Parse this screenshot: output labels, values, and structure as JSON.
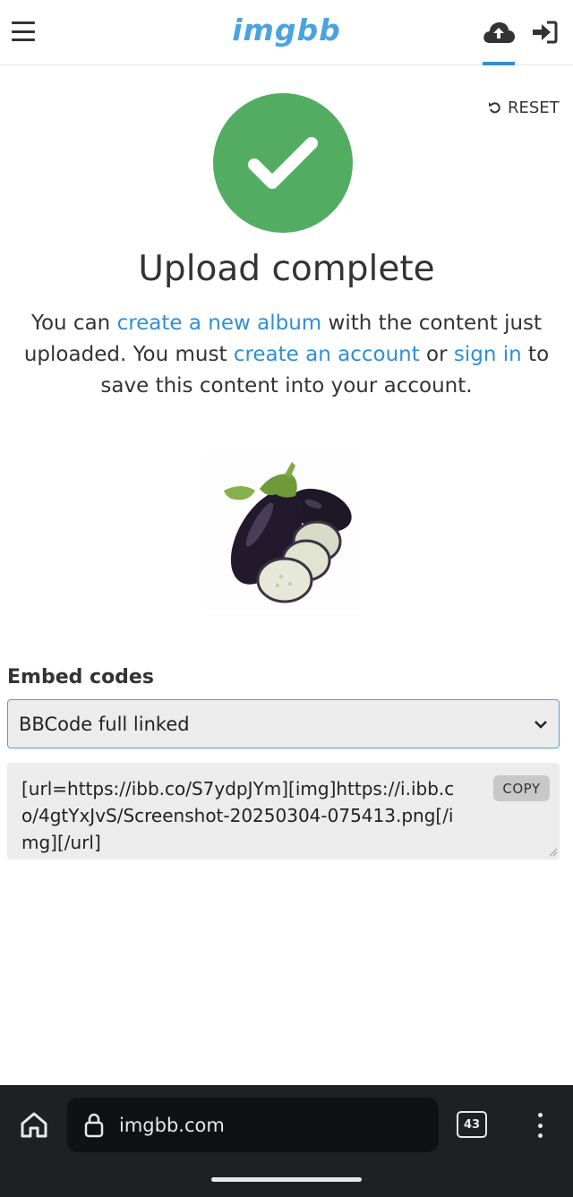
{
  "header": {
    "logo": "imgbb",
    "brand_color": "#4aa3e0",
    "icons": [
      "menu-icon",
      "cloud-upload-icon",
      "sign-in-icon"
    ]
  },
  "reset": {
    "label": "RESET",
    "icon": "undo-icon"
  },
  "success": {
    "icon": "checkmark-icon",
    "color": "#52ad63",
    "title": "Upload complete",
    "message": {
      "part1": "You can ",
      "link_album": "create a new album",
      "part2": " with the content just uploaded. You must ",
      "link_account": "create an account",
      "part3": " or ",
      "link_signin": "sign in",
      "part4": " to save this content into your account."
    }
  },
  "embed": {
    "label": "Embed codes",
    "selected": "BBCode full linked",
    "code": "[url=https://ibb.co/S7ydpJYm][img]https://i.ibb.co/4gtYxJvS/Screenshot-20250304-075413.png[/img][/url]",
    "copy_label": "COPY"
  },
  "browser": {
    "url": "imgbb.com",
    "tab_count": "43",
    "link_color": "#2f8fd6"
  }
}
